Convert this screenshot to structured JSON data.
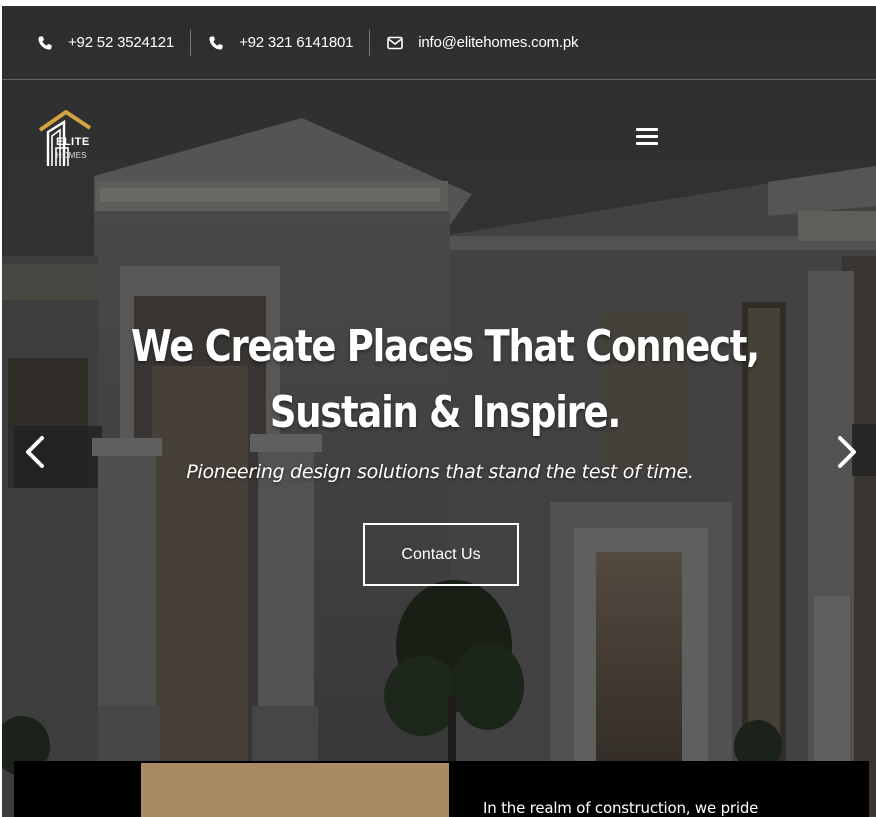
{
  "topbar": {
    "phone1": "+92 52 3524121",
    "phone2": "+92 321 6141801",
    "email": "info@elitehomes.com.pk"
  },
  "logo": {
    "line1": "ELITE",
    "line2": "HOMES"
  },
  "hero": {
    "headline_line1": "We Create Places That Connect,",
    "headline_line2": "Sustain & Inspire.",
    "subheadline": "Pioneering design solutions that stand the test of time.",
    "cta_label": "Contact Us"
  },
  "intro": {
    "text": "In the realm of construction, we pride"
  },
  "colors": {
    "accent_gold": "#a88b63",
    "logo_gold": "#d4a442",
    "text": "#ffffff"
  },
  "icons": [
    "phone-icon",
    "phone-icon",
    "mail-icon",
    "menu-icon",
    "chevron-left-icon",
    "chevron-right-icon"
  ]
}
